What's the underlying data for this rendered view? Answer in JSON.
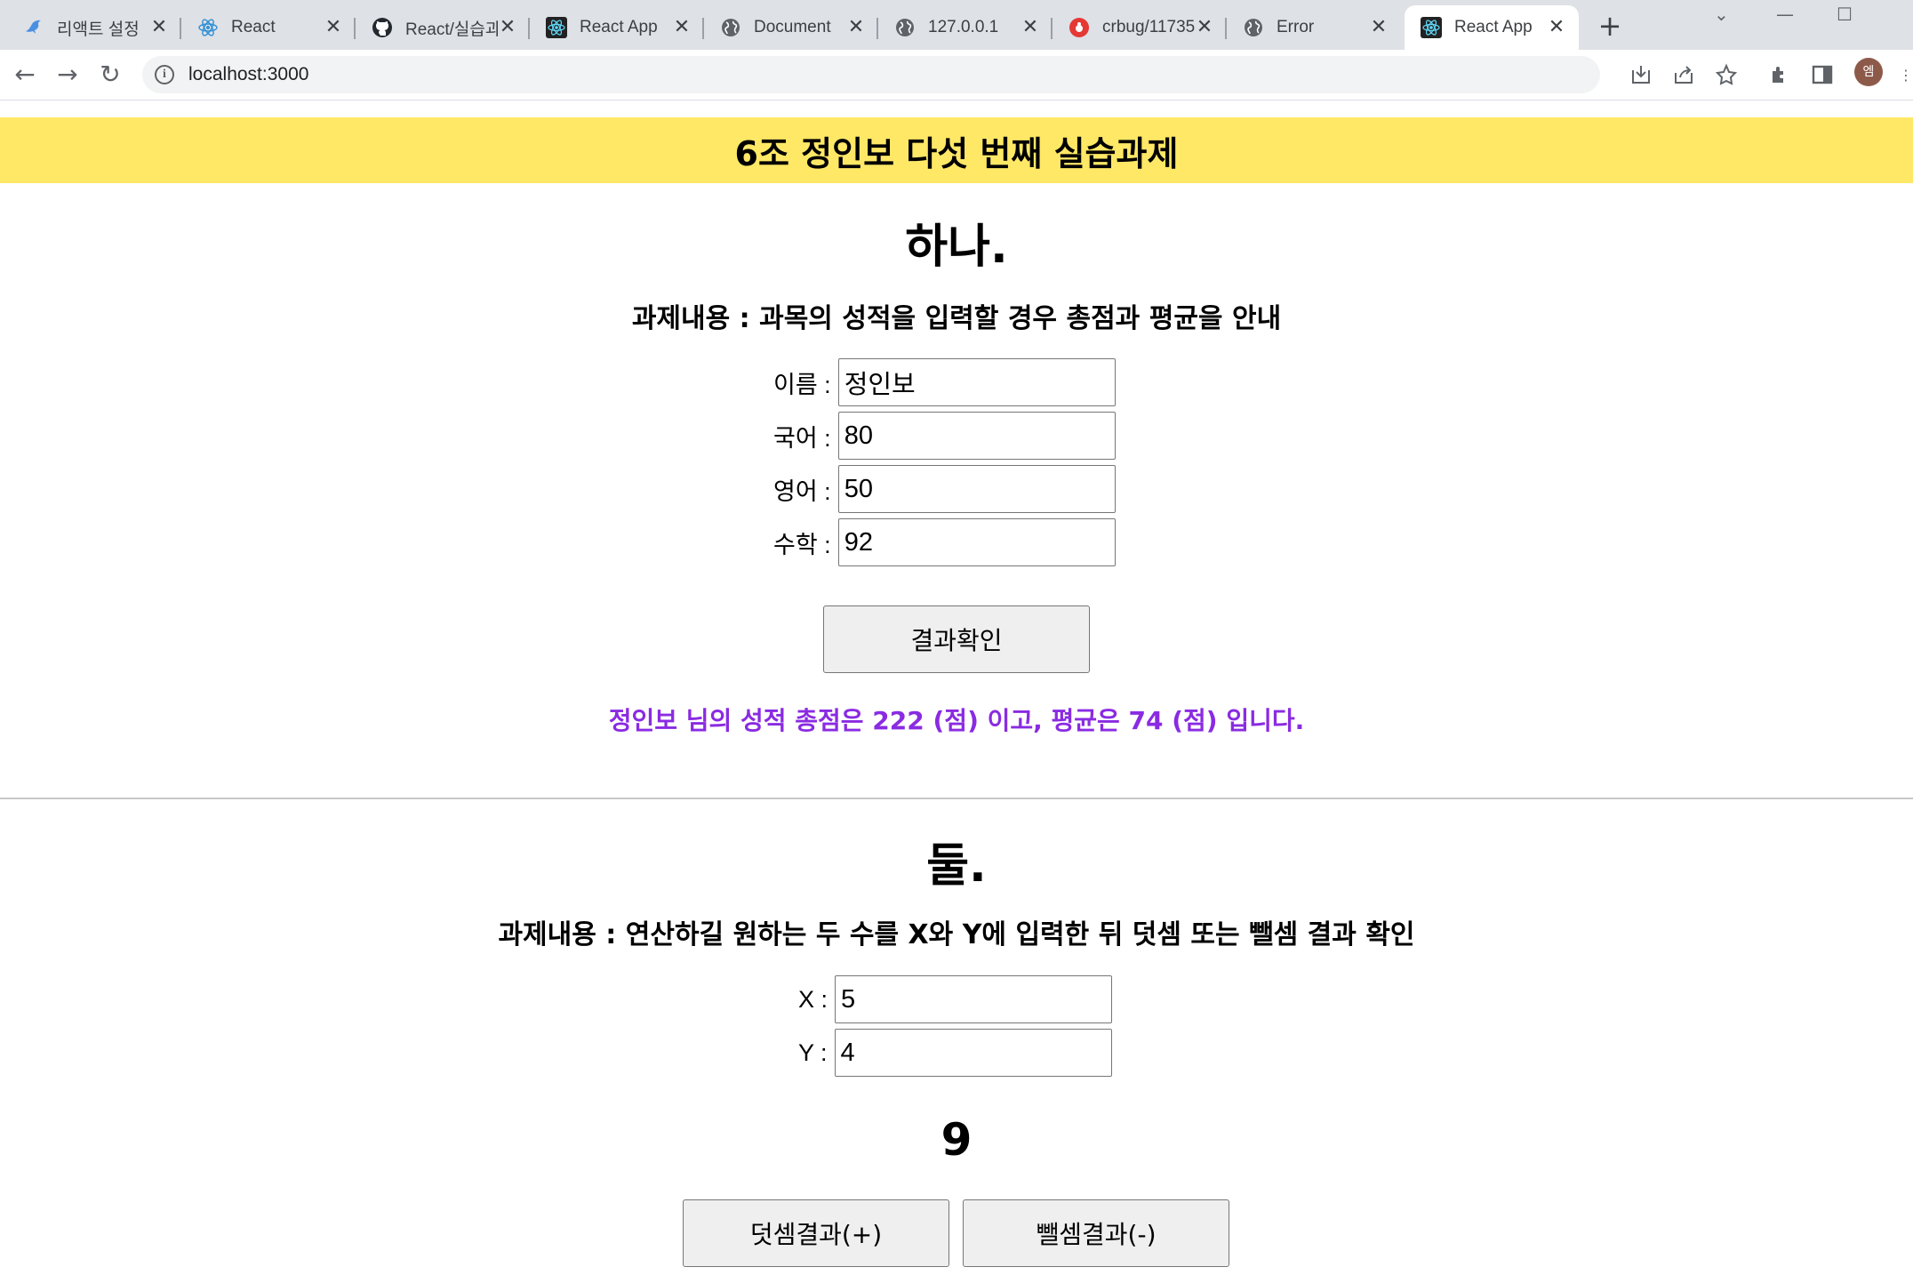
{
  "browser": {
    "tabs": [
      {
        "title": "리액트 설정",
        "icon": "dolphin-icon",
        "active": false
      },
      {
        "title": "React",
        "icon": "react-icon",
        "active": false
      },
      {
        "title": "React/실습과",
        "icon": "github-icon",
        "active": false
      },
      {
        "title": "React App",
        "icon": "react-app-icon",
        "active": false
      },
      {
        "title": "Document",
        "icon": "globe-icon",
        "active": false
      },
      {
        "title": "127.0.0.1",
        "icon": "globe-icon",
        "active": false
      },
      {
        "title": "crbug/11735",
        "icon": "bug-icon",
        "active": false
      },
      {
        "title": "Error",
        "icon": "globe-icon",
        "active": false
      },
      {
        "title": "React App",
        "icon": "react-app-icon",
        "active": true
      }
    ],
    "url": "localhost:3000",
    "profile_initial": "엠"
  },
  "page": {
    "banner_title": "6조 정인보 다섯 번째 실습과제",
    "section1": {
      "heading": "하나.",
      "description": "과제내용 : 과목의 성적을 입력할 경우 총점과 평균을 안내",
      "fields": [
        {
          "label": "이름 :",
          "value": "정인보"
        },
        {
          "label": "국어 :",
          "value": "80"
        },
        {
          "label": "영어 :",
          "value": "50"
        },
        {
          "label": "수학 :",
          "value": "92"
        }
      ],
      "button_label": "결과확인",
      "result_text": "정인보 님의 성적 총점은 222 (점) 이고, 평균은 74 (점) 입니다.",
      "result_color": "#8a2be2"
    },
    "section2": {
      "heading": "둘.",
      "description": "과제내용 : 연산하길 원하는 두 수를 X와 Y에 입력한 뒤 덧셈 또는 뺄셈 결과 확인",
      "fields": [
        {
          "label": "X :",
          "value": "5"
        },
        {
          "label": "Y :",
          "value": "4"
        }
      ],
      "result": "9",
      "add_button_label": "덧셈결과(+)",
      "sub_button_label": "뺄셈결과(-)"
    },
    "banner_color": "#ffe866"
  }
}
